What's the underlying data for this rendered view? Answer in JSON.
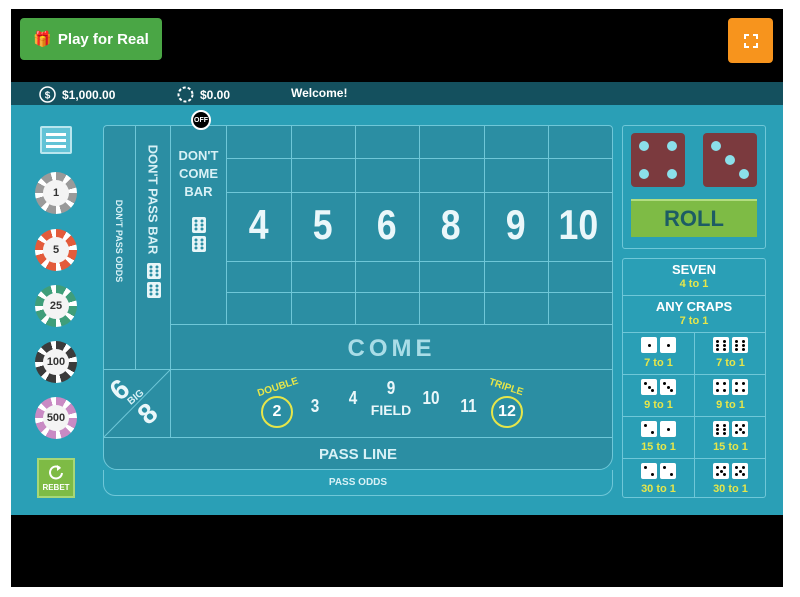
{
  "header": {
    "play_for_real_label": "Play for Real",
    "gift_icon": "🎁"
  },
  "status": {
    "balance": "$1,000.00",
    "bet_total": "$0.00",
    "message": "Welcome!"
  },
  "chips": [
    "1",
    "5",
    "25",
    "100",
    "500"
  ],
  "chip_colors": {
    "chip_1": "#e8e8e8",
    "chip_5": "#e35b3b",
    "chip_25": "#3f9e7a",
    "chip_100": "#3b3b3b",
    "chip_500": "#c98ac4"
  },
  "rebet_label": "REBET",
  "table": {
    "dont_pass_odds": "DON'T PASS ODDS",
    "dont_pass_bar": "DON'T PASS BAR",
    "dont_come_bar": [
      "DON'T",
      "COME",
      "BAR"
    ],
    "place_numbers": [
      "4",
      "5",
      "6",
      "8",
      "9",
      "10"
    ],
    "come": "COME",
    "big_6": "6",
    "big_8": "8",
    "big_label": "BIG",
    "field_double_label": "DOUBLE",
    "field_triple_label": "TRIPLE",
    "field_numbers": {
      "two": "2",
      "three": "3",
      "four": "4",
      "nine": "9",
      "ten": "10",
      "eleven": "11",
      "twelve": "12"
    },
    "field_label": "FIELD",
    "pass_line": "PASS LINE",
    "pass_odds": "PASS ODDS",
    "puck": "OFF"
  },
  "dice": {
    "die1": 4,
    "die2": 3
  },
  "roll_label": "ROLL",
  "props": {
    "seven": {
      "label": "SEVEN",
      "odds": "4 to 1"
    },
    "any_craps": {
      "label": "ANY CRAPS",
      "odds": "7 to 1"
    },
    "hardways": [
      {
        "dice": [
          1,
          1
        ],
        "odds": "7 to 1"
      },
      {
        "dice": [
          6,
          6
        ],
        "odds": "7 to 1"
      },
      {
        "dice": [
          3,
          3
        ],
        "odds": "9 to 1"
      },
      {
        "dice": [
          4,
          4
        ],
        "odds": "9 to 1"
      },
      {
        "dice": [
          2,
          1
        ],
        "odds": "15 to 1"
      },
      {
        "dice": [
          6,
          5
        ],
        "odds": "15 to 1"
      },
      {
        "dice": [
          2,
          2
        ],
        "odds": "30 to 1"
      },
      {
        "dice": [
          5,
          5
        ],
        "odds": "30 to 1"
      }
    ]
  }
}
